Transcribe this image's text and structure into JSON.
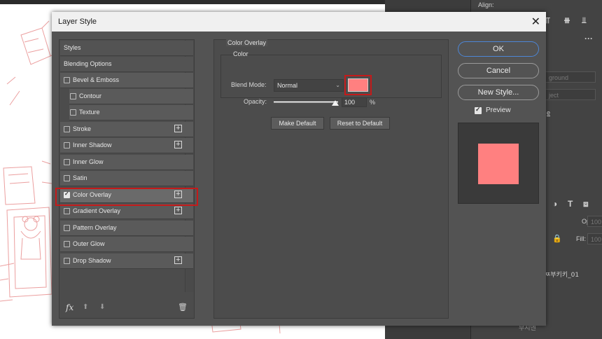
{
  "background": {
    "right_panel": {
      "align_label": "Align:",
      "field_ground": "ground",
      "field_ject": "ject",
      "link_fragment": "e",
      "opacity_label": "Opacity:",
      "opacity_value": "100",
      "fill_label": "Fill:",
      "fill_value": "100",
      "layer_name": "ㅉ부키키_01",
      "layer_name2": "무시엔"
    }
  },
  "dialog": {
    "title": "Layer Style",
    "close_glyph": "✕",
    "styles_list": [
      {
        "label": "Styles",
        "type": "header"
      },
      {
        "label": "Blending Options",
        "type": "header"
      },
      {
        "label": "Bevel & Emboss",
        "checked": false,
        "plus": false
      },
      {
        "label": "Contour",
        "checked": false,
        "plus": false,
        "indent": true
      },
      {
        "label": "Texture",
        "checked": false,
        "plus": false,
        "indent": true
      },
      {
        "label": "Stroke",
        "checked": false,
        "plus": true
      },
      {
        "label": "Inner Shadow",
        "checked": false,
        "plus": true
      },
      {
        "label": "Inner Glow",
        "checked": false,
        "plus": false
      },
      {
        "label": "Satin",
        "checked": false,
        "plus": false
      },
      {
        "label": "Color Overlay",
        "checked": true,
        "plus": true,
        "selected": true
      },
      {
        "label": "Gradient Overlay",
        "checked": false,
        "plus": true
      },
      {
        "label": "Pattern Overlay",
        "checked": false,
        "plus": false
      },
      {
        "label": "Outer Glow",
        "checked": false,
        "plus": false
      },
      {
        "label": "Drop Shadow",
        "checked": false,
        "plus": true
      }
    ],
    "fx_label": "fx",
    "up_glyph": "⬆",
    "down_glyph": "⬇",
    "trash_glyph": "🗑",
    "plus_glyph": "+",
    "color_overlay": {
      "section_title": "Color Overlay",
      "group_title": "Color",
      "blend_mode_label": "Blend Mode:",
      "blend_mode_value": "Normal",
      "chevron": "⌄",
      "color": "#ff8080",
      "opacity_label": "Opacity:",
      "opacity_value": "100",
      "opacity_unit": "%",
      "opacity_fraction": 1.0,
      "make_default": "Make Default",
      "reset_default": "Reset to Default"
    },
    "buttons": {
      "ok": "OK",
      "cancel": "Cancel",
      "new_style": "New Style..."
    },
    "preview": {
      "label": "Preview",
      "checked": true,
      "color": "#ff8080"
    },
    "highlight_color": "#c41a1a"
  }
}
